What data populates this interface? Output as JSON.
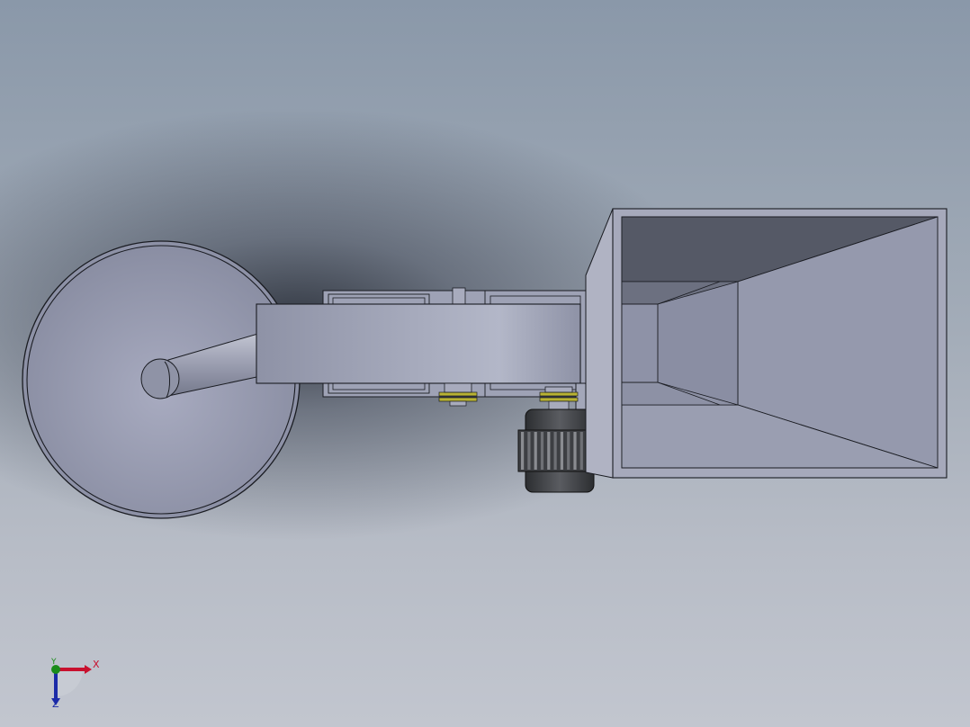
{
  "viewport": {
    "background_top": "#8a98a9",
    "background_bottom": "#c2c6cf"
  },
  "model": {
    "parts": [
      {
        "name": "wheel",
        "icon": "wheel-disc"
      },
      {
        "name": "shaft",
        "icon": "cylinder"
      },
      {
        "name": "gear-housing",
        "icon": "box"
      },
      {
        "name": "pulleys",
        "icon": "pulley"
      },
      {
        "name": "motor",
        "icon": "motor"
      },
      {
        "name": "hopper",
        "icon": "funnel"
      }
    ],
    "colors": {
      "body": "#9a9fb3",
      "edge": "#1a1c22",
      "motor": "#3a3c40",
      "pulley_accent": "#b8b233"
    }
  },
  "triad": {
    "x_label": "X",
    "y_label": "Y",
    "z_label": "Z",
    "x_color": "#c8102e",
    "y_color": "#1a8c1a",
    "z_color": "#1b2aa8"
  }
}
